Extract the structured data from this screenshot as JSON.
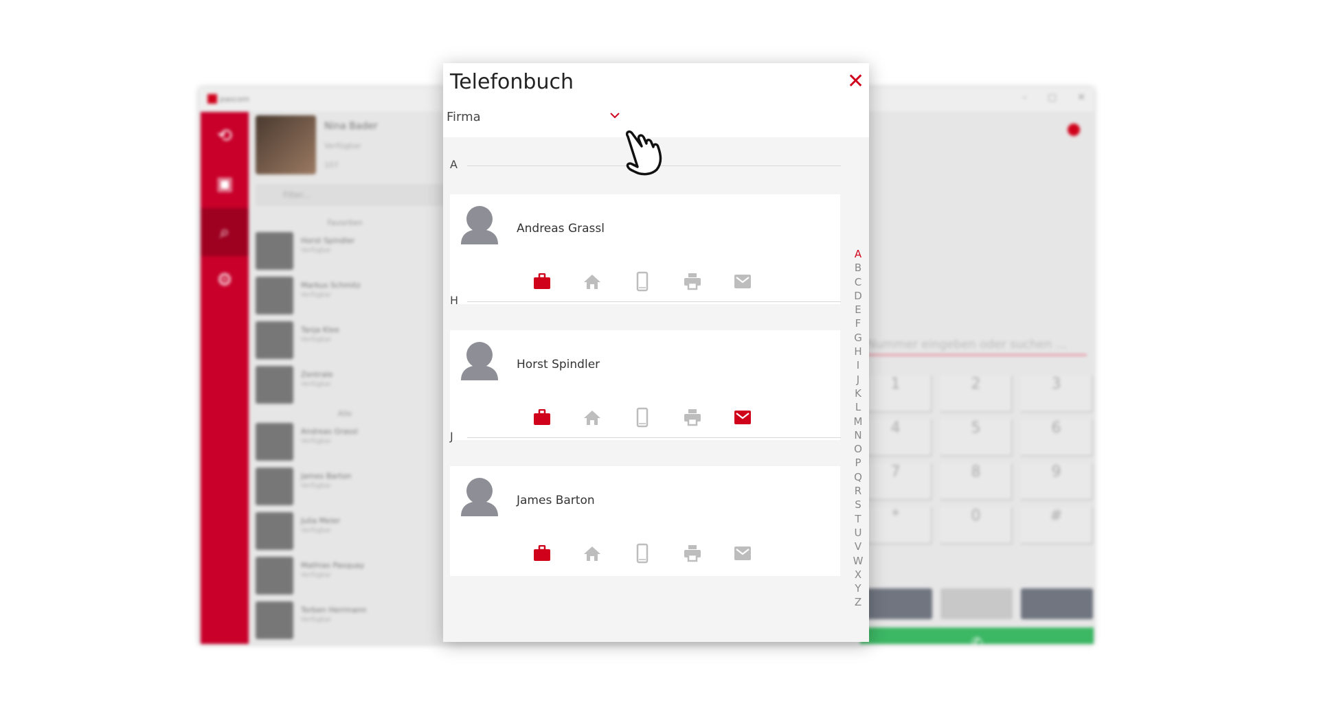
{
  "colors": {
    "accent": "#d0021b",
    "icon_inactive": "#bdbdbd",
    "avatar": "#8e8e96",
    "call_green": "#3cb764"
  },
  "background_app": {
    "brand": "pascom",
    "profile": {
      "name": "Nina Bader",
      "status": "Verfügbar",
      "extension": "107"
    },
    "filter_placeholder": "Filter...",
    "groups": [
      {
        "label": "Favoriten",
        "items": [
          {
            "name": "Horst Spindler",
            "status": "Verfügbar"
          },
          {
            "name": "Markus Schmitz",
            "status": "Verfügbar"
          },
          {
            "name": "Tanja Klee",
            "status": "Verfügbar"
          },
          {
            "name": "Zentrale",
            "status": "Verfügbar"
          }
        ]
      },
      {
        "label": "Alle",
        "items": [
          {
            "name": "Andreas Grassl",
            "status": "Verfügbar"
          },
          {
            "name": "James Barton",
            "status": "Verfügbar"
          },
          {
            "name": "Julia Meier",
            "status": "Verfügbar"
          },
          {
            "name": "Mathias Pasquay",
            "status": "Verfügbar"
          },
          {
            "name": "Torben Herrmann",
            "status": "Verfügbar"
          }
        ]
      }
    ],
    "dialer": {
      "placeholder": "Nummer eingeben oder suchen ...",
      "keys": [
        "1",
        "2",
        "3",
        "4",
        "5",
        "6",
        "7",
        "8",
        "9",
        "*",
        "0",
        "#"
      ]
    }
  },
  "dialog": {
    "title": "Telefonbuch",
    "close_icon": "close-x",
    "phonebook_select": {
      "value": "Firma"
    },
    "sections": [
      {
        "letter": "A",
        "contacts": [
          {
            "name": "Andreas Grassl",
            "active": [
              "work"
            ]
          }
        ]
      },
      {
        "letter": "H",
        "contacts": [
          {
            "name": "Horst Spindler",
            "active": [
              "work",
              "mail"
            ]
          }
        ]
      },
      {
        "letter": "J",
        "contacts": [
          {
            "name": "James Barton",
            "active": [
              "work"
            ]
          }
        ]
      }
    ],
    "contact_icons": [
      "work",
      "home",
      "mobile",
      "fax",
      "mail"
    ],
    "alphabet": [
      "A",
      "B",
      "C",
      "D",
      "E",
      "F",
      "G",
      "H",
      "I",
      "J",
      "K",
      "L",
      "M",
      "N",
      "O",
      "P",
      "Q",
      "R",
      "S",
      "T",
      "U",
      "V",
      "W",
      "X",
      "Y",
      "Z"
    ],
    "alphabet_selected": "A"
  }
}
